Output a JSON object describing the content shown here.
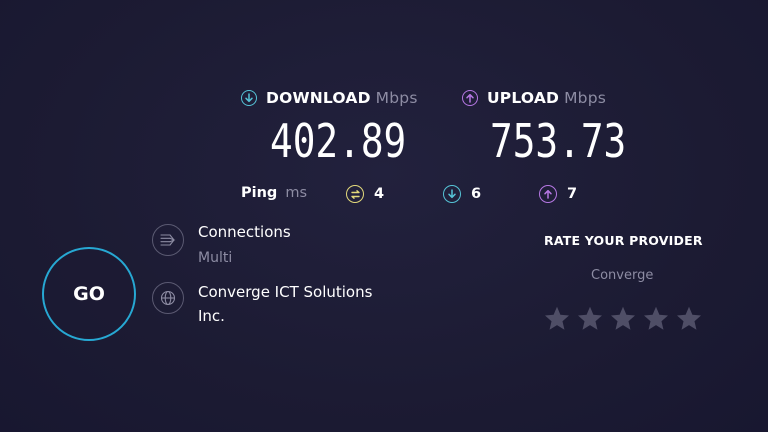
{
  "download": {
    "label": "DOWNLOAD",
    "unit": "Mbps",
    "value": "402.89",
    "icon": "download-arrow-icon",
    "color": "#55c3d6"
  },
  "upload": {
    "label": "UPLOAD",
    "unit": "Mbps",
    "value": "753.73",
    "icon": "upload-arrow-icon",
    "color": "#b577e3"
  },
  "ping": {
    "label": "Ping",
    "unit": "ms",
    "idle": {
      "value": "4",
      "icon": "ping-idle-icon",
      "color": "#e3d97b"
    },
    "download": {
      "value": "6",
      "icon": "download-arrow-icon",
      "color": "#55c3d6"
    },
    "upload": {
      "value": "7",
      "icon": "upload-arrow-icon",
      "color": "#b577e3"
    }
  },
  "go_button": {
    "label": "GO",
    "ring_color": "#27a8d3"
  },
  "connections": {
    "title": "Connections",
    "value": "Multi",
    "icon": "connections-icon"
  },
  "provider": {
    "name_line1": "Converge ICT Solutions",
    "name_line2": "Inc.",
    "icon": "globe-icon"
  },
  "rate": {
    "title": "RATE YOUR PROVIDER",
    "provider_name": "Converge",
    "stars": 5,
    "rating": 0,
    "star_color": "#4f4e66"
  }
}
